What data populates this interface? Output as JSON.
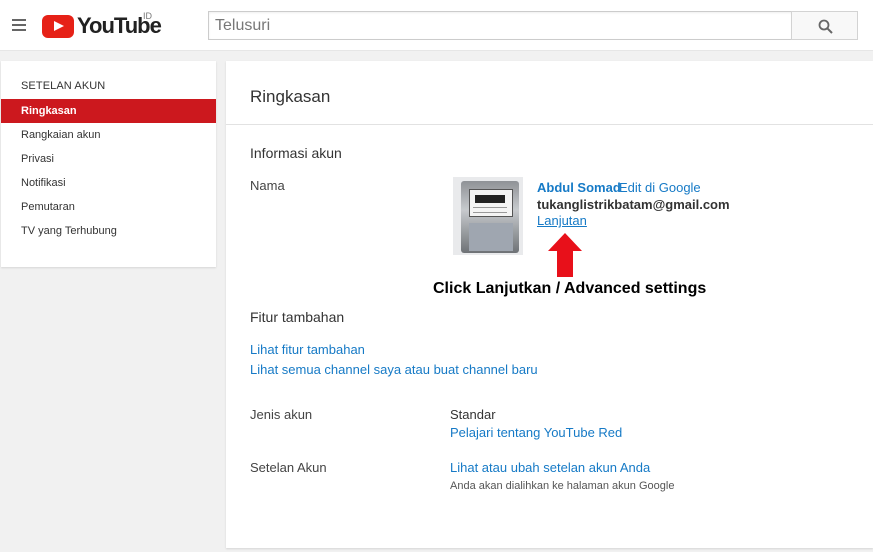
{
  "header": {
    "logo_text": "YouTube",
    "region": "ID",
    "search_placeholder": "Telusuri"
  },
  "sidebar": {
    "heading": "SETELAN AKUN",
    "items": [
      {
        "label": "Ringkasan",
        "active": true
      },
      {
        "label": "Rangkaian akun",
        "active": false
      },
      {
        "label": "Privasi",
        "active": false
      },
      {
        "label": "Notifikasi",
        "active": false
      },
      {
        "label": "Pemutaran",
        "active": false
      },
      {
        "label": "TV yang Terhubung",
        "active": false
      }
    ]
  },
  "main": {
    "title": "Ringkasan",
    "account_info": {
      "heading": "Informasi akun",
      "name_label": "Nama",
      "user_name": "Abdul Somad",
      "edit_link": "Edit di Google",
      "email": "tukanglistrikbatam@gmail.com",
      "advanced_link": "Lanjutan"
    },
    "annotation": "Click Lanjutkan / Advanced settings",
    "features": {
      "heading": "Fitur tambahan",
      "link1": "Lihat fitur tambahan",
      "link2": "Lihat semua channel saya atau buat channel baru"
    },
    "account_type": {
      "label": "Jenis akun",
      "value": "Standar",
      "link": "Pelajari tentang YouTube Red"
    },
    "account_settings": {
      "label": "Setelan Akun",
      "link": "Lihat atau ubah setelan akun Anda",
      "note": "Anda akan dialihkan ke halaman akun Google"
    }
  },
  "colors": {
    "accent": "#cc181e",
    "link": "#167ac6",
    "arrow": "#e8101a"
  }
}
